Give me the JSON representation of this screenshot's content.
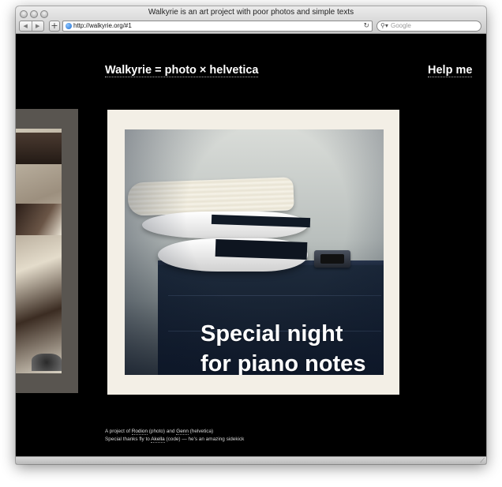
{
  "window": {
    "title": "Walkyrie is an art project with poor photos and simple texts"
  },
  "toolbar": {
    "back_label": "◀",
    "forward_label": "▶",
    "add_label": "+",
    "url": "http://walkyrie.org/#1",
    "reload_label": "↻",
    "search_placeholder": "Google",
    "search_icon": "magnifier-dropdown-icon"
  },
  "site": {
    "title": "Walkyrie = photo × helvetica",
    "help_link": "Help me"
  },
  "photo": {
    "caption_line1": "Special night",
    "caption_line2": "for piano notes"
  },
  "footer": {
    "line1_prefix": "A project of ",
    "rodion": "Rodion",
    "line1_mid1": " (photo) and ",
    "genn": "Genn",
    "line1_mid2": " (helvetica)",
    "line2_prefix": "Special thanks fly to ",
    "akella": "Akella",
    "line2_suffix": " (code) — he's an amazing sidekick"
  },
  "colors": {
    "page_background": "#000000",
    "photo_frame": "#f3efe6",
    "text": "#ffffff"
  }
}
